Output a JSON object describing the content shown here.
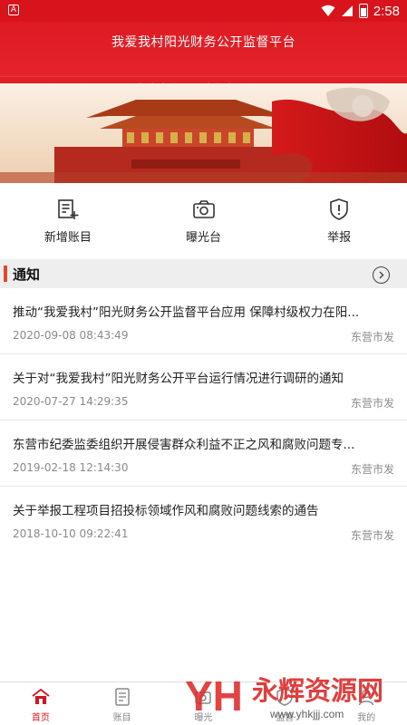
{
  "status_bar": {
    "left_indicator": "A",
    "time": "2:58"
  },
  "header": {
    "title": "我爱我村阳光财务公开监督平台",
    "login_prompt": "您尚未登录，请点这里登录!"
  },
  "quick_actions": [
    {
      "label": "新增账目",
      "icon": "add-ledger-icon"
    },
    {
      "label": "曝光台",
      "icon": "camera-icon"
    },
    {
      "label": "举报",
      "icon": "shield-alert-icon"
    }
  ],
  "notices": {
    "title": "通知",
    "items": [
      {
        "title": "推动“我爱我村”阳光财务公开监督平台应用 保障村级权力在阳...",
        "date": "2020-09-08 08:43:49",
        "source": "东营市发"
      },
      {
        "title": "关于对“我爱我村”阳光财务公开平台运行情况进行调研的通知",
        "date": "2020-07-27 14:29:35",
        "source": "东营市发"
      },
      {
        "title": "东营市纪委监委组织开展侵害群众利益不正之风和腐败问题专...",
        "date": "2019-02-18 12:14:30",
        "source": "东营市发"
      },
      {
        "title": "关于举报工程项目招投标领域作风和腐败问题线索的通告",
        "date": "2018-10-10 09:22:41",
        "source": "东营市发"
      }
    ]
  },
  "tabbar": [
    {
      "label": "首页",
      "icon": "home-icon",
      "active": true
    },
    {
      "label": "账目",
      "icon": "ledger-icon",
      "active": false
    },
    {
      "label": "曝光",
      "icon": "exposure-icon",
      "active": false
    },
    {
      "label": "监督",
      "icon": "supervise-icon",
      "active": false
    },
    {
      "label": "我的",
      "icon": "profile-icon",
      "active": false
    }
  ],
  "watermark": {
    "brand": "永辉资源网",
    "url": "www.yhkjjj.com",
    "letters": "YH"
  },
  "colors": {
    "primary_red": "#d9131b",
    "accent_orange": "#e24b2a",
    "muted_text": "#8a8a8a"
  }
}
